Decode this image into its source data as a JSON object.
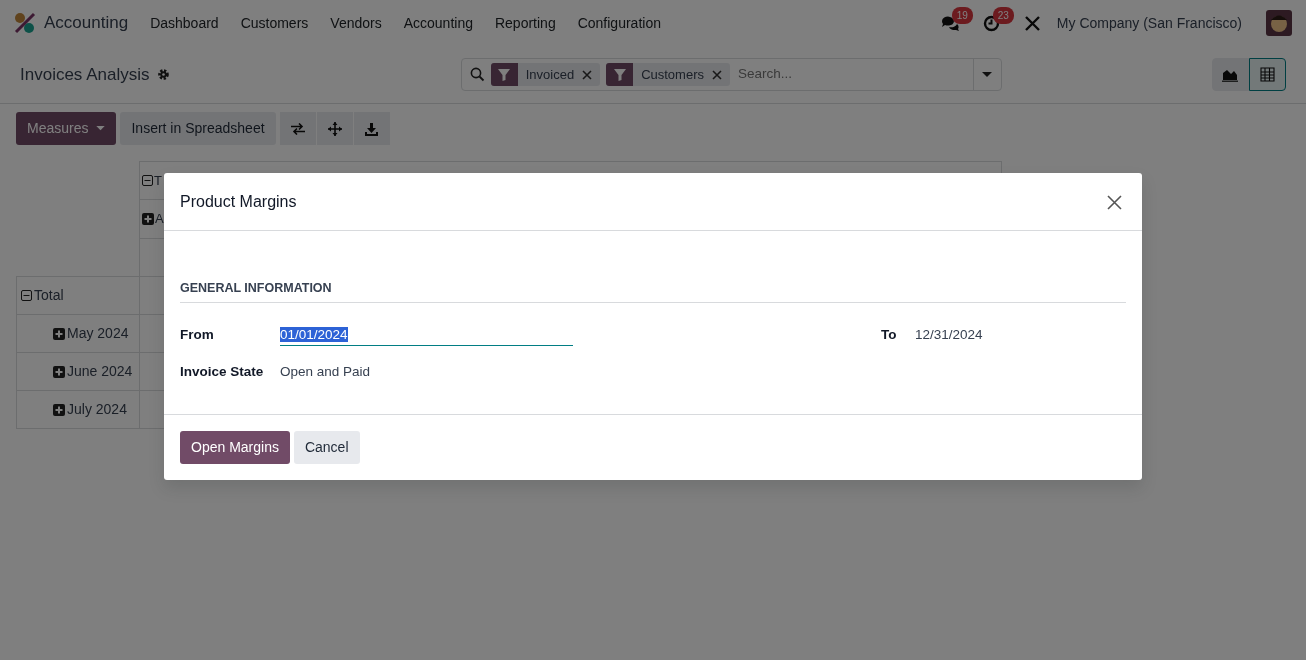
{
  "navbar": {
    "app_name": "Accounting",
    "menu": [
      "Dashboard",
      "Customers",
      "Vendors",
      "Accounting",
      "Reporting",
      "Configuration"
    ],
    "messages_count": "19",
    "activities_count": "23",
    "company": "My Company (San Francisco)"
  },
  "control_panel": {
    "title": "Invoices Analysis",
    "facets": [
      {
        "label": "Invoiced"
      },
      {
        "label": "Customers"
      }
    ],
    "search_placeholder": "Search...",
    "views": [
      {
        "kind": "graph",
        "selected": false
      },
      {
        "kind": "pivot",
        "selected": true
      }
    ]
  },
  "toolbar": {
    "measures": "Measures",
    "insert": "Insert in Spreadsheet"
  },
  "pivot": {
    "column_headers": [
      {
        "label": "T",
        "expanded": true
      },
      {
        "label": "A",
        "expanded": false
      }
    ],
    "rows": [
      {
        "label": "Total",
        "expanded": true,
        "children": [
          {
            "label": "May 2024",
            "expanded": false
          },
          {
            "label": "June 2024",
            "expanded": false
          },
          {
            "label": "July 2024",
            "expanded": false
          }
        ]
      }
    ]
  },
  "dialog": {
    "title": "Product Margins",
    "section": "GENERAL INFORMATION",
    "from_label": "From",
    "from_value": "01/01/2024",
    "to_label": "To",
    "to_value": "12/31/2024",
    "state_label": "Invoice State",
    "state_value": "Open and Paid",
    "primary_button": "Open Margins",
    "cancel_button": "Cancel"
  }
}
